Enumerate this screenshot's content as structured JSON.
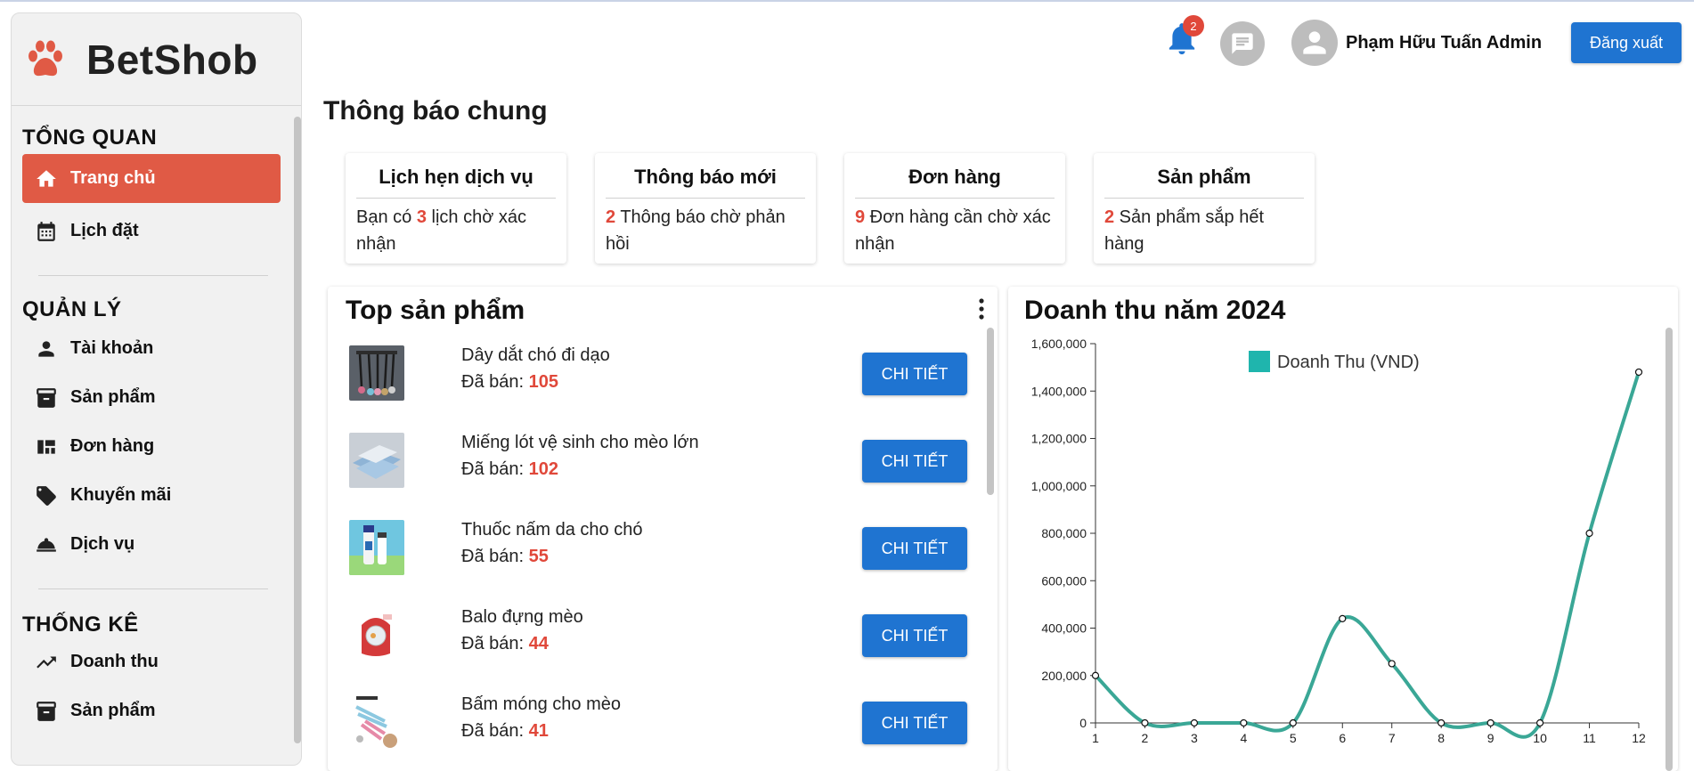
{
  "app": {
    "brand": "BetShob"
  },
  "header": {
    "notification_count": "2",
    "user_name": "Phạm Hữu Tuấn Admin",
    "logout_label": "Đăng xuất"
  },
  "sidebar": {
    "sections": [
      {
        "title": "TỔNG QUAN",
        "items": [
          {
            "label": "Trang chủ",
            "icon": "home-icon",
            "active": true
          },
          {
            "label": "Lịch đặt",
            "icon": "calendar-icon"
          }
        ]
      },
      {
        "title": "QUẢN LÝ",
        "items": [
          {
            "label": "Tài khoản",
            "icon": "person-icon"
          },
          {
            "label": "Sản phẩm",
            "icon": "archive-icon"
          },
          {
            "label": "Đơn hàng",
            "icon": "dashboard-icon"
          },
          {
            "label": "Khuyến mãi",
            "icon": "tag-icon"
          },
          {
            "label": "Dịch vụ",
            "icon": "service-bell-icon"
          }
        ]
      },
      {
        "title": "THỐNG KÊ",
        "items": [
          {
            "label": "Doanh thu",
            "icon": "trending-up-icon"
          },
          {
            "label": "Sản phẩm",
            "icon": "archive-icon"
          }
        ]
      }
    ]
  },
  "main": {
    "title": "Thông báo chung",
    "cards": [
      {
        "title": "Lịch hẹn dịch vụ",
        "prefix": "Bạn có ",
        "number": "3",
        "suffix": " lịch chờ xác nhận"
      },
      {
        "title": "Thông báo mới",
        "prefix": "",
        "number": "2",
        "suffix": " Thông báo chờ phản hồi"
      },
      {
        "title": "Đơn hàng",
        "prefix": "",
        "number": "9",
        "suffix": " Đơn hàng cần chờ xác nhận"
      },
      {
        "title": "Sản phẩm",
        "prefix": "",
        "number": "2",
        "suffix": " Sản phẩm sắp hết hàng"
      }
    ],
    "top_products": {
      "title": "Top sản phẩm",
      "sold_label": "Đã bán: ",
      "button_label": "CHI TIẾT",
      "items": [
        {
          "name": "Dây dắt chó đi dạo",
          "sold": "105"
        },
        {
          "name": "Miếng lót vệ sinh cho mèo lớn",
          "sold": "102"
        },
        {
          "name": "Thuốc nấm da cho chó",
          "sold": "55"
        },
        {
          "name": "Balo đựng mèo",
          "sold": "44"
        },
        {
          "name": "Bấm móng cho mèo",
          "sold": "41"
        }
      ]
    },
    "revenue": {
      "title": "Doanh thu năm 2024"
    }
  },
  "chart_data": {
    "type": "line",
    "x": [
      1,
      2,
      3,
      4,
      5,
      6,
      7,
      8,
      9,
      10,
      11,
      12
    ],
    "series": [
      {
        "name": "Doanh Thu (VND)",
        "values": [
          200000,
          0,
          0,
          0,
          0,
          440000,
          250000,
          0,
          0,
          0,
          800000,
          1480000
        ]
      }
    ],
    "ylim": [
      0,
      1600000
    ],
    "yticks": [
      "0",
      "200,000",
      "400,000",
      "600,000",
      "800,000",
      "1,000,000",
      "1,200,000",
      "1,400,000",
      "1,600,000"
    ],
    "xticks": [
      "1",
      "2",
      "3",
      "4",
      "5",
      "6",
      "7",
      "8",
      "9",
      "10",
      "11",
      "12"
    ],
    "legend": "top",
    "color": "#3aa796",
    "legend_color": "#1fb5ad"
  },
  "colors": {
    "accent": "#e05a45",
    "primary": "#1f74d1",
    "highlight": "#e0483a"
  }
}
